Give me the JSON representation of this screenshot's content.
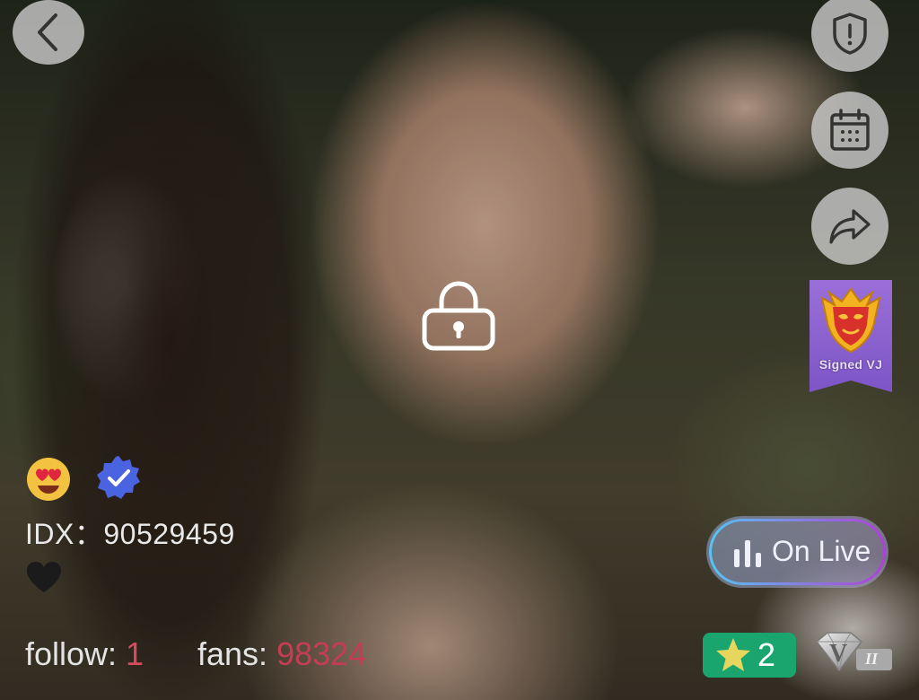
{
  "user": {
    "idx_label": "IDX：",
    "idx_value": "90529459"
  },
  "stats": {
    "follow_label": "follow: ",
    "follow_value": "1",
    "fans_label": "fans: ",
    "fans_value": "98324"
  },
  "live_button": {
    "label": "On Live"
  },
  "signed_badge": {
    "label": "Signed VJ"
  },
  "level_badge": {
    "value": "2"
  },
  "vip_badge": {
    "letter": "V",
    "level": "II"
  },
  "icons": {
    "back": "chevron-left-icon",
    "report": "shield-alert-icon",
    "calendar": "calendar-icon",
    "share": "share-arrow-icon",
    "lock": "lock-icon",
    "emoji": "heart-eyes-emoji-icon",
    "verified": "verified-badge-icon",
    "heart": "heart-icon",
    "live": "bar-chart-icon",
    "star": "star-icon"
  },
  "colors": {
    "live_border_start": "#57c4f2",
    "live_border_end": "#b03fd9",
    "fans_value": "#c53d52",
    "level_badge_bg": "#1aa56f",
    "verified_blue": "#4a63e0"
  }
}
